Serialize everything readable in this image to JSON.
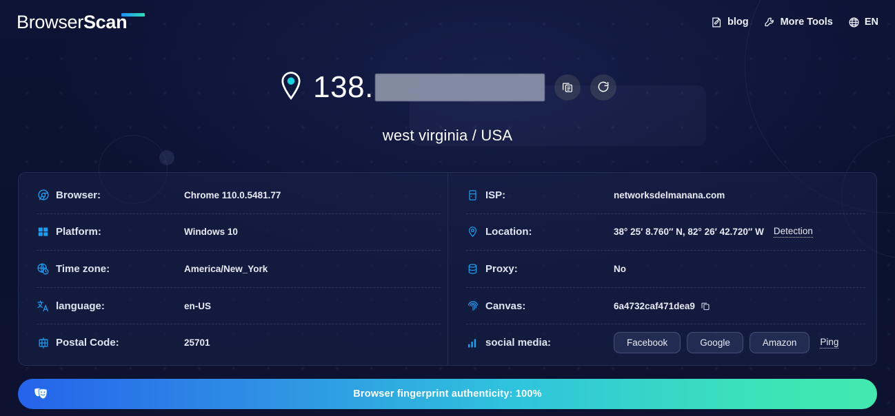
{
  "header": {
    "logo_light": "Browser",
    "logo_bold": "Scan",
    "nav": [
      {
        "label": "blog",
        "icon": "document-pencil-icon"
      },
      {
        "label": "More Tools",
        "icon": "wrench-icon"
      },
      {
        "label": "EN",
        "icon": "globe-icon"
      }
    ]
  },
  "hero": {
    "ip_prefix": "138.",
    "ip_masked": "███.███.███",
    "copy_button": "copy-icon",
    "refresh_button": "refresh-icon",
    "location": "west virginia / USA",
    "pin_icon": "location-pin-icon"
  },
  "card": {
    "left_rows": [
      {
        "icon": "chrome-icon",
        "label": "Browser:",
        "value": "Chrome 110.0.5481.77"
      },
      {
        "icon": "windows-icon",
        "label": "Platform:",
        "value": "Windows 10"
      },
      {
        "icon": "timezone-icon",
        "label": "Time zone:",
        "value": "America/New_York"
      },
      {
        "icon": "translate-icon",
        "label": "language:",
        "value": "en-US"
      },
      {
        "icon": "postal-icon",
        "label": "Postal Code:",
        "value": "25701"
      }
    ],
    "right_rows": [
      {
        "icon": "server-icon",
        "label": "ISP:",
        "value": "networksdelmanana.com"
      },
      {
        "icon": "location-pin-icon",
        "label": "Location:",
        "value": "38° 25′ 8.760″ N, 82° 26′ 42.720″ W",
        "link": "Detection"
      },
      {
        "icon": "database-icon",
        "label": "Proxy:",
        "value": "No"
      },
      {
        "icon": "fingerprint-icon",
        "label": "Canvas:",
        "value": "6a4732caf471dea9",
        "copy": "copy-icon"
      },
      {
        "icon": "bar-chart-icon",
        "label": "social media:",
        "buttons": [
          "Facebook",
          "Google",
          "Amazon"
        ],
        "link": "Ping"
      }
    ]
  },
  "bottom": {
    "icon": "theater-masks-icon",
    "text": "Browser fingerprint authenticity: 100%"
  },
  "colors": {
    "background": "#0c1230",
    "accent_blue": "#1f9cf0",
    "gradient_start": "#2563eb",
    "gradient_end": "#43e9ae",
    "card_bg": "#192248"
  }
}
